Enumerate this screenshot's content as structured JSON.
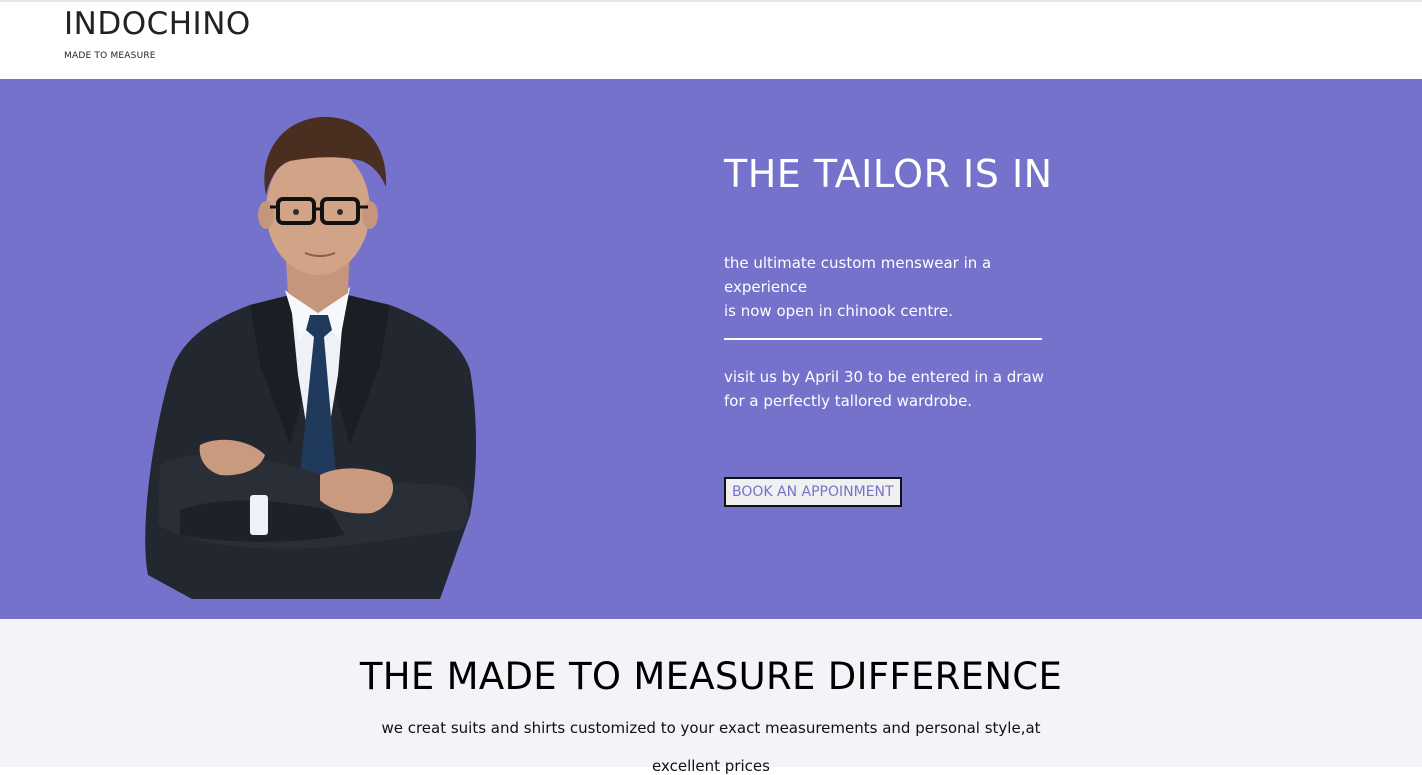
{
  "header": {
    "brand": "INDOCHINO",
    "tagline": "MADE TO MEASURE"
  },
  "hero": {
    "title": "THE TAILOR IS IN",
    "text_line1": "the ultimate custom menswear in a experience",
    "text_line2": "is now open in chinook centre.",
    "promo_line1": "visit us by April 30 to be entered in a draw",
    "promo_line2": "for a perfectly tallored wardrobe.",
    "button_label": "BOOK AN APPOINMENT",
    "background_color": "#7472ca",
    "portrait_icon": "man-in-suit-portrait"
  },
  "difference": {
    "title": "THE MADE TO MEASURE DIFFERENCE",
    "text_line1": "we creat suits and shirts customized to your exact measurements and personal style,at",
    "text_line2": "excellent prices"
  }
}
